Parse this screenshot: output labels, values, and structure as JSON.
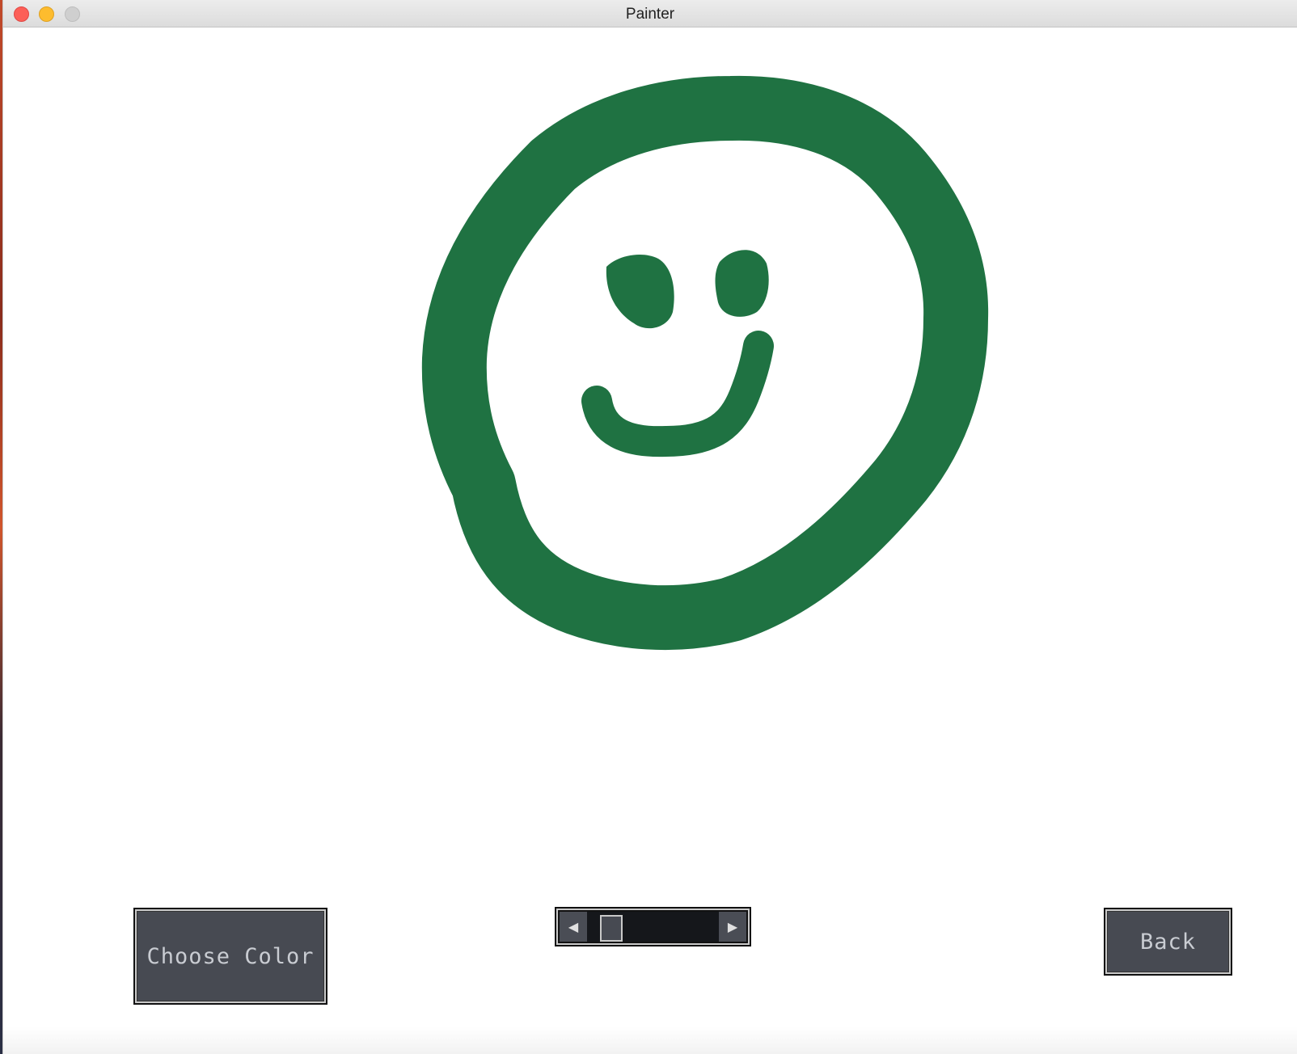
{
  "window": {
    "title": "Painter"
  },
  "colors": {
    "brush": "#1f7242",
    "button_bg": "#474a52",
    "button_text": "#c9ccd2"
  },
  "controls": {
    "choose_color_label": "Choose Color",
    "back_label": "Back",
    "size_slider": {
      "value_fraction": 0.12,
      "left_icon": "triangle-left",
      "right_icon": "triangle-right"
    }
  },
  "drawing": {
    "description_icon": "smiley-face-drawing"
  }
}
